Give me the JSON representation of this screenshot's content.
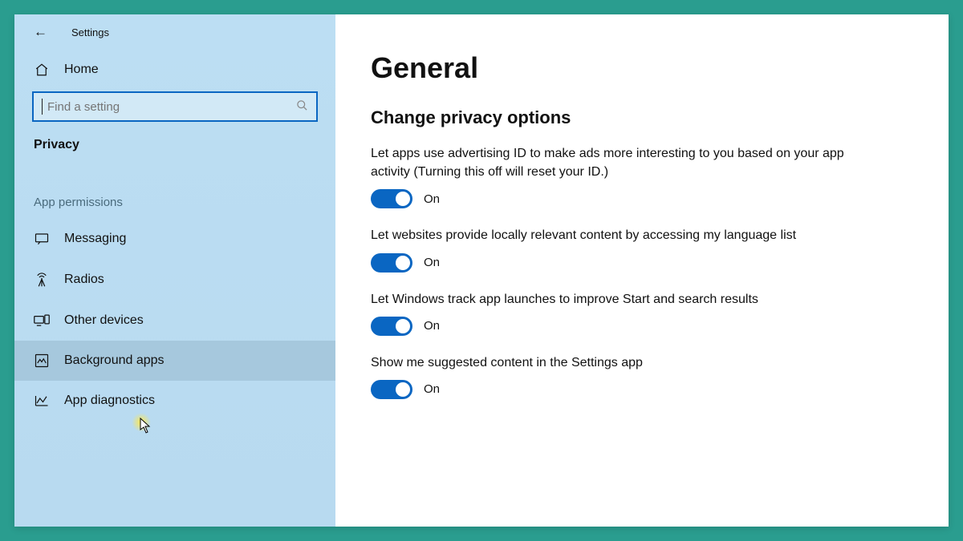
{
  "window_title": "Settings",
  "sidebar": {
    "home_label": "Home",
    "search": {
      "placeholder": "Find a setting"
    },
    "section_label": "Privacy",
    "group_label": "App permissions",
    "items": [
      {
        "label": "Messaging"
      },
      {
        "label": "Radios"
      },
      {
        "label": "Other devices"
      },
      {
        "label": "Background apps"
      },
      {
        "label": "App diagnostics"
      }
    ]
  },
  "content": {
    "page_title": "General",
    "subhead": "Change privacy options",
    "options": [
      {
        "desc": "Let apps use advertising ID to make ads more interesting to you based on your app activity (Turning this off will reset your ID.)",
        "state_label": "On"
      },
      {
        "desc": "Let websites provide locally relevant content by accessing my language list",
        "state_label": "On"
      },
      {
        "desc": "Let Windows track app launches to improve Start and search results",
        "state_label": "On"
      },
      {
        "desc": "Show me suggested content in the Settings app",
        "state_label": "On"
      }
    ]
  },
  "colors": {
    "accent": "#0a66c2",
    "frame": "#2a9d8f"
  }
}
